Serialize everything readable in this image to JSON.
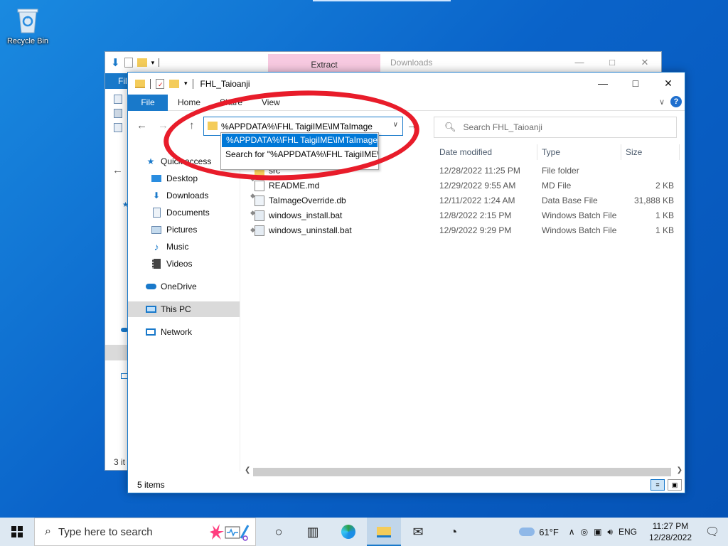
{
  "desktop": {
    "recycle_bin_label": "Recycle Bin"
  },
  "back_window": {
    "extract_tab": "Extract",
    "title": "Downloads",
    "file_tab": "Fil",
    "status": "3 it"
  },
  "window": {
    "title": "FHL_Taioanji",
    "ribbon_tabs": [
      "File",
      "Home",
      "Share",
      "View"
    ],
    "address_value": "%APPDATA%\\FHL TaigiIME\\IMTaImage",
    "search_placeholder": "Search FHL_Taioanji",
    "suggestions": [
      "%APPDATA%\\FHL TaigiIME\\IMTaImage",
      "Search for \"%APPDATA%\\FHL TaigiIME\\I"
    ],
    "nav_pane": {
      "quick_access": "Quick access",
      "items": [
        {
          "label": "Desktop",
          "icon": "desktop-icon"
        },
        {
          "label": "Downloads",
          "icon": "download-icon"
        },
        {
          "label": "Documents",
          "icon": "documents-icon"
        },
        {
          "label": "Pictures",
          "icon": "pictures-icon"
        },
        {
          "label": "Music",
          "icon": "music-icon"
        },
        {
          "label": "Videos",
          "icon": "videos-icon"
        }
      ],
      "onedrive": "OneDrive",
      "this_pc": "This PC",
      "network": "Network"
    },
    "columns": {
      "date": "Date modified",
      "type": "Type",
      "size": "Size"
    },
    "files": [
      {
        "name": "src",
        "date": "12/28/2022 11:25 PM",
        "type": "File folder",
        "size": ""
      },
      {
        "name": "README.md",
        "date": "12/29/2022 9:55 AM",
        "type": "MD File",
        "size": "2 KB"
      },
      {
        "name": "TaImageOverride.db",
        "date": "12/11/2022 1:24 AM",
        "type": "Data Base File",
        "size": "31,888 KB"
      },
      {
        "name": "windows_install.bat",
        "date": "12/8/2022 2:15 PM",
        "type": "Windows Batch File",
        "size": "1 KB"
      },
      {
        "name": "windows_uninstall.bat",
        "date": "12/9/2022 9:29 PM",
        "type": "Windows Batch File",
        "size": "1 KB"
      }
    ],
    "status": "5 items"
  },
  "taskbar": {
    "search_placeholder": "Type here to search",
    "weather": "61°F",
    "language": "ENG",
    "time": "11:27 PM",
    "date": "12/28/2022"
  },
  "colors": {
    "accent": "#1979ca",
    "annotation": "#e81c2a",
    "selection": "#0078d7"
  }
}
